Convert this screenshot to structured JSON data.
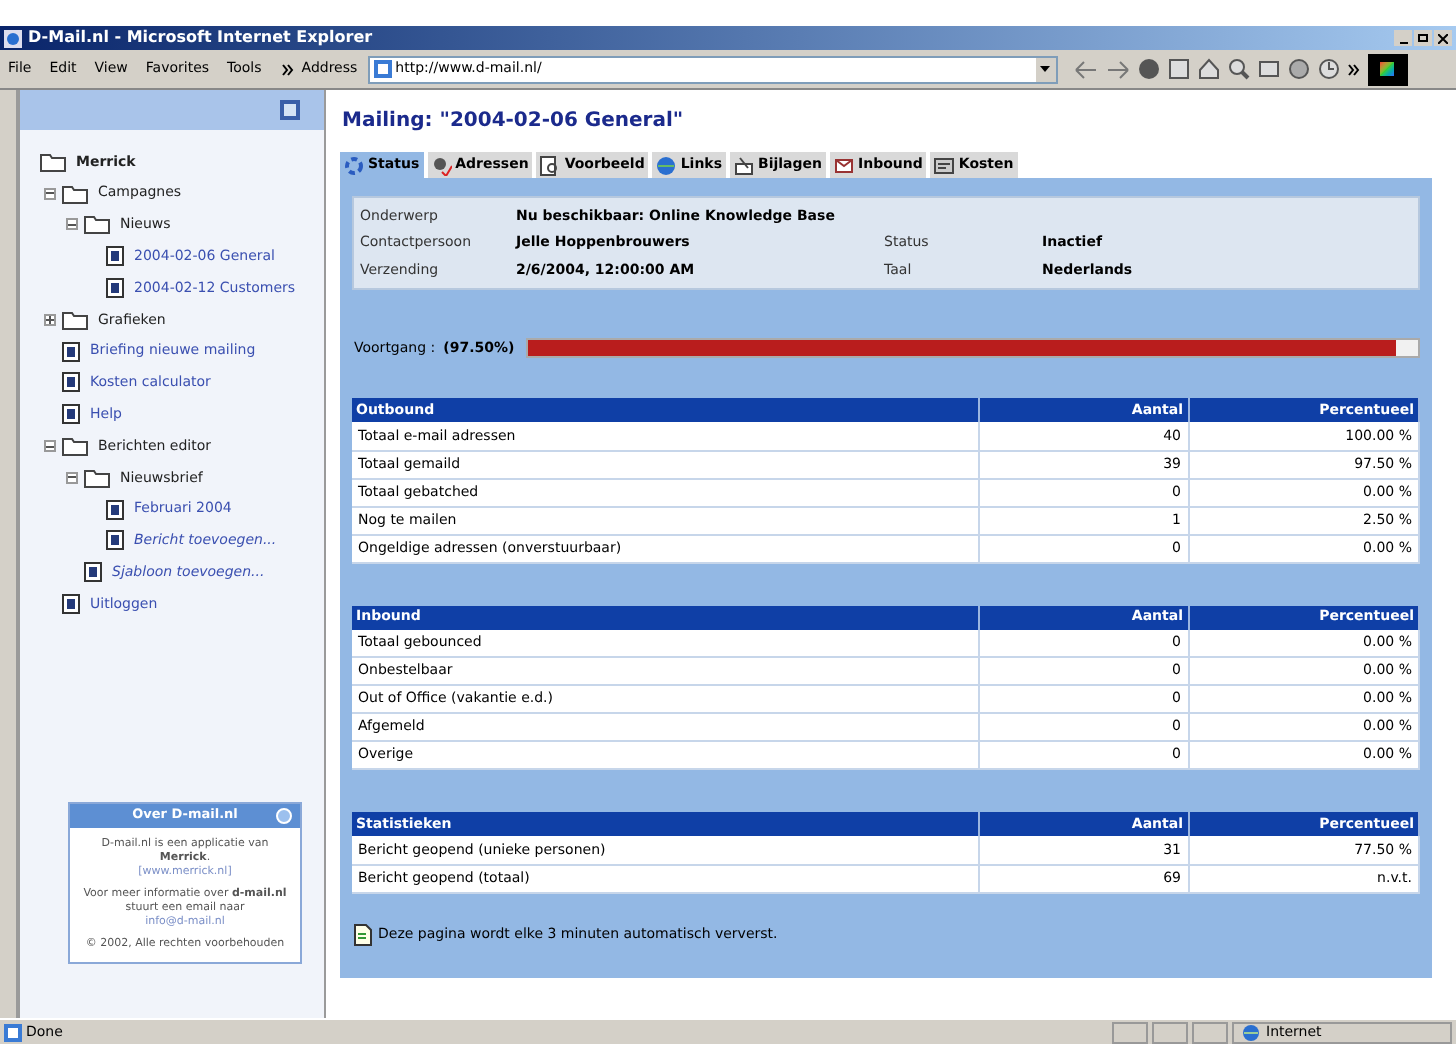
{
  "window": {
    "title": "D-Mail.nl - Microsoft Internet Explorer"
  },
  "menu": [
    "File",
    "Edit",
    "View",
    "Favorites",
    "Tools"
  ],
  "address": {
    "label": "Address",
    "value": "http://www.d-mail.nl/"
  },
  "sidebar": {
    "tree": [
      {
        "label": "Merrick",
        "kind": "folder",
        "children": [
          {
            "label": "Campagnes",
            "kind": "folder",
            "expanded": true,
            "children": [
              {
                "label": "Nieuws",
                "kind": "folder",
                "expanded": true,
                "children": [
                  {
                    "label": "2004-02-06 General",
                    "kind": "doc",
                    "italic": false
                  },
                  {
                    "label": "2004-02-12 Customers",
                    "kind": "doc",
                    "italic": false
                  }
                ]
              }
            ]
          },
          {
            "label": "Grafieken",
            "kind": "folder",
            "expanded": false
          },
          {
            "label": "Briefing nieuwe mailing",
            "kind": "doc",
            "italic": false
          },
          {
            "label": "Kosten calculator",
            "kind": "doc",
            "italic": false
          },
          {
            "label": "Help",
            "kind": "doc",
            "italic": false
          },
          {
            "label": "Berichten editor",
            "kind": "folder",
            "expanded": true,
            "children": [
              {
                "label": "Nieuwsbrief",
                "kind": "folder",
                "expanded": true,
                "children": [
                  {
                    "label": "Februari 2004",
                    "kind": "doc",
                    "italic": false
                  },
                  {
                    "label": "Bericht toevoegen...",
                    "kind": "doc",
                    "italic": true
                  }
                ]
              },
              {
                "label": "Sjabloon toevoegen...",
                "kind": "doc",
                "italic": true
              }
            ]
          },
          {
            "label": "Uitloggen",
            "kind": "doc",
            "italic": false
          }
        ]
      }
    ],
    "about": {
      "title": "Over D-mail.nl",
      "paragraphs": [
        {
          "text": "D-mail.nl is een applicatie van **Merrick**.",
          "link": "[www.merrick.nl]"
        },
        {
          "text": "Voor meer informatie over **d-mail.nl** stuurt een email naar",
          "link": "info@d-mail.nl"
        },
        {
          "text": "© 2002, Alle rechten voorbehouden"
        }
      ]
    }
  },
  "page": {
    "title": "Mailing: \"2004-02-06 General\"",
    "tabs": [
      {
        "label": "Status",
        "selected": true
      },
      {
        "label": "Adressen",
        "selected": false
      },
      {
        "label": "Voorbeeld",
        "selected": false
      },
      {
        "label": "Links",
        "selected": false
      },
      {
        "label": "Bijlagen",
        "selected": false
      },
      {
        "label": "Inbound",
        "selected": false
      },
      {
        "label": "Kosten",
        "selected": false
      }
    ],
    "info": [
      [
        "Onderwerp",
        "Nu beschikbaar: Online Knowledge Base"
      ],
      [
        "Contactpersoon",
        "Jelle Hoppenbrouwers",
        "Status",
        "Inactief"
      ],
      [
        "Verzending",
        "2/6/2004, 12:00:00 AM",
        "Taal",
        "Nederlands"
      ]
    ],
    "progress": {
      "label": "Voortgang :",
      "reading": "(97.50%)",
      "level": 0.975
    },
    "tables": [
      {
        "columns": [
          "Outbound",
          "Aantal",
          "Percentueel"
        ],
        "rows": [
          [
            "Totaal e-mail adressen",
            "40",
            "100.00 %"
          ],
          [
            "Totaal gemaild",
            "39",
            "97.50 %"
          ],
          [
            "Totaal gebatched",
            "0",
            "0.00 %"
          ],
          [
            "Nog te mailen",
            "1",
            "2.50 %"
          ],
          [
            "Ongeldige adressen (onverstuurbaar)",
            "0",
            "0.00 %"
          ]
        ]
      },
      {
        "columns": [
          "Inbound",
          "Aantal",
          "Percentueel"
        ],
        "rows": [
          [
            "Totaal gebounced",
            "0",
            "0.00 %"
          ],
          [
            "Onbestelbaar",
            "0",
            "0.00 %"
          ],
          [
            "Out of Office (vakantie e.d.)",
            "0",
            "0.00 %"
          ],
          [
            "Afgemeld",
            "0",
            "0.00 %"
          ],
          [
            "Overige",
            "0",
            "0.00 %"
          ]
        ]
      },
      {
        "columns": [
          "Statistieken",
          "Aantal",
          "Percentueel"
        ],
        "rows": [
          [
            "Bericht geopend (unieke personen)",
            "31",
            "77.50 %"
          ],
          [
            "Bericht geopend (totaal)",
            "69",
            "n.v.t."
          ]
        ]
      }
    ],
    "note": "Deze pagina wordt elke 3 minuten automatisch ververst."
  },
  "status_bar": {
    "text": "Done",
    "zone": "Internet"
  }
}
